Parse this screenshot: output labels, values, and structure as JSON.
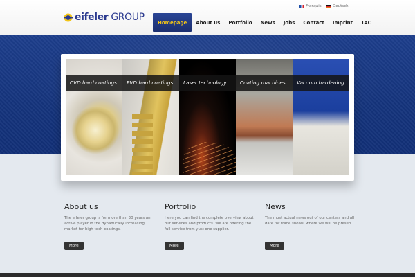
{
  "logo": {
    "brand_bold": "eifeler",
    "brand_rest": " GROUP",
    "icon": "eifeler-logo-mark"
  },
  "languages": [
    {
      "label": "Français",
      "flag": "flag-fr-icon"
    },
    {
      "label": "Deutsch",
      "flag": "flag-de-icon"
    }
  ],
  "nav": [
    {
      "label": "Homepage",
      "active": true
    },
    {
      "label": "About us"
    },
    {
      "label": "Portfolio"
    },
    {
      "label": "News"
    },
    {
      "label": "Jobs"
    },
    {
      "label": "Contact"
    },
    {
      "label": "Imprint"
    },
    {
      "label": "TAC"
    }
  ],
  "slider": {
    "items": [
      {
        "caption": "CVD hard coatings"
      },
      {
        "caption": "PVD hard coatings"
      },
      {
        "caption": "Laser technology"
      },
      {
        "caption": "Coating machines"
      },
      {
        "caption": "Vacuum hardening"
      }
    ]
  },
  "columns": [
    {
      "title": "About us",
      "text": "The eifeler group is for more than 30 years an active player in the dynamically increasing market for high-tech coatings.",
      "button": "More"
    },
    {
      "title": "Portfolio",
      "text": "Here you can find the complete overview about our services and products. We are offering the full service from yust one supplier.",
      "button": "More"
    },
    {
      "title": "News",
      "text": "The most actual news out of our centers and all date for trade shows, where we will be presen.",
      "button": "More"
    }
  ],
  "colors": {
    "nav_active_bg": "#223a85",
    "nav_active_text": "#f3c516",
    "band": "#15347d",
    "brand": "#2b3a8f"
  }
}
